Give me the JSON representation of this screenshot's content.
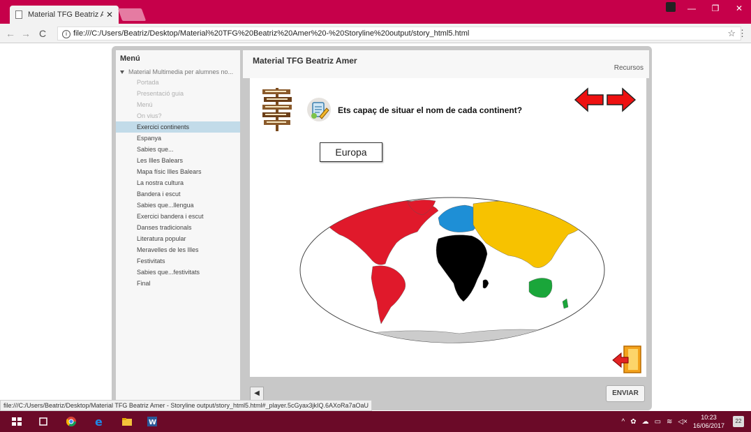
{
  "browser": {
    "tab_title": "Material TFG Beatriz Ame",
    "tab_close": "✕",
    "url": "file:///C:/Users/Beatriz/Desktop/Material%20TFG%20Beatriz%20Amer%20-%20Storyline%20output/story_html5.html",
    "status_url": "file:///C:/Users/Beatriz/Desktop/Material TFG Beatriz Amer - Storyline output/story_html5.html#_player.5cGyax3jkIQ.6AXoRa7aOaU",
    "accent_color": "#c6004a"
  },
  "player": {
    "course_title": "Material TFG Beatriz Amer",
    "resources_label": "Recursos",
    "menu_title": "Menú",
    "menu_root": "Material Multimedia per alumnes no...",
    "menu_items": [
      {
        "label": "Portada",
        "state": "visited"
      },
      {
        "label": "Presentació guia",
        "state": "visited"
      },
      {
        "label": "Menú",
        "state": "visited"
      },
      {
        "label": "On vius?",
        "state": "visited"
      },
      {
        "label": "Exercici continents",
        "state": "selected"
      },
      {
        "label": "Espanya",
        "state": "normal"
      },
      {
        "label": "Sabies que...",
        "state": "normal"
      },
      {
        "label": "Les Illes Balears",
        "state": "normal"
      },
      {
        "label": "Mapa físic Illes Balears",
        "state": "normal"
      },
      {
        "label": "La nostra cultura",
        "state": "normal"
      },
      {
        "label": "Bandera i escut",
        "state": "normal"
      },
      {
        "label": "Sabies que...llengua",
        "state": "normal"
      },
      {
        "label": "Exercici bandera i escut",
        "state": "normal"
      },
      {
        "label": "Danses tradicionals",
        "state": "normal"
      },
      {
        "label": "Literatura popular",
        "state": "normal"
      },
      {
        "label": "Meravelles de les Illes",
        "state": "normal"
      },
      {
        "label": "Festivitats",
        "state": "normal"
      },
      {
        "label": "Sabies que...festivitats",
        "state": "normal"
      },
      {
        "label": "Final",
        "state": "normal"
      }
    ],
    "submit_label": "ENVIAR"
  },
  "slide": {
    "question": "Ets capaç de situar el nom de cada continent?",
    "drag_label": "Europa",
    "continent_colors": {
      "america": "#e0192b",
      "europe": "#1e8fd6",
      "asia": "#f7c200",
      "africa": "#000000",
      "oceania": "#1aa63a",
      "antarctica": "#cccccc"
    }
  },
  "taskbar": {
    "time": "10:23",
    "date": "16/06/2017",
    "notifications": "22"
  }
}
